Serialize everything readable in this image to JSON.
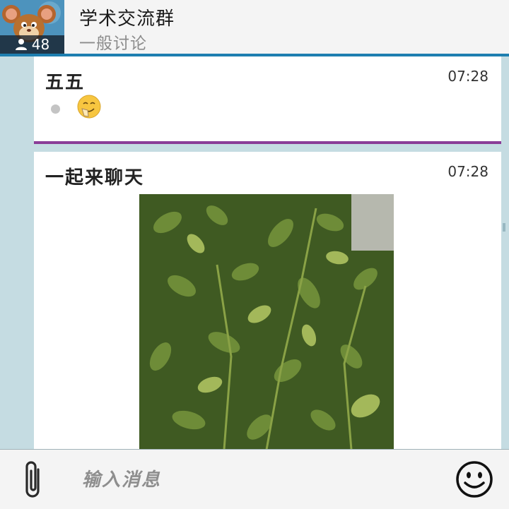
{
  "header": {
    "title": "学术交流群",
    "subtitle": "一般讨论",
    "member_count": "48"
  },
  "messages": [
    {
      "sender": "五五",
      "time": "07:28",
      "content_type": "emoji"
    },
    {
      "sender": "一起来聊天",
      "time": "07:28",
      "content_type": "image"
    }
  ],
  "composer": {
    "placeholder": "输入消息"
  },
  "icons": {
    "attach": "paperclip-icon",
    "emoji": "smiley-icon",
    "members": "person-icon"
  },
  "colors": {
    "header_accent": "#1e7fb0",
    "unread_divider": "#8a3d98",
    "background": "#c5dce2"
  }
}
